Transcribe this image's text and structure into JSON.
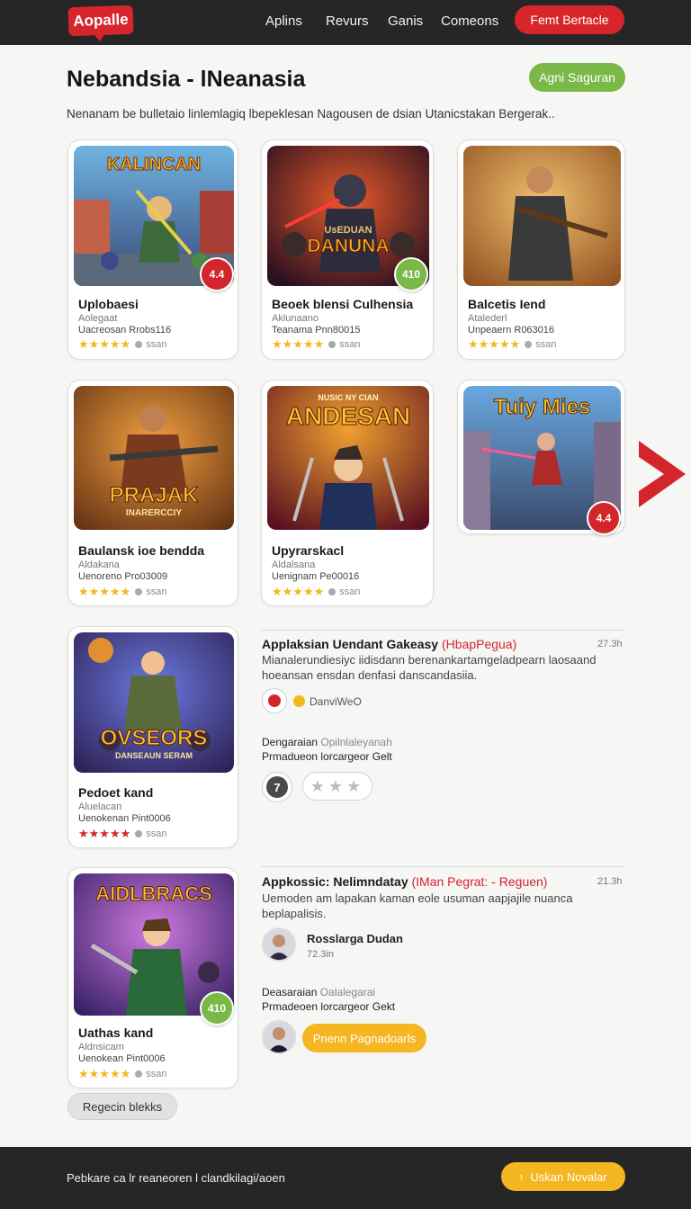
{
  "app": {
    "logo": "Aopalle"
  },
  "nav": {
    "items": [
      "Aplins",
      "Revurs",
      "Ganis",
      "Comeons"
    ],
    "cta": "Femt Bertacle"
  },
  "header": {
    "title": "Nebandsia - lNeanasia",
    "button": "Agni Saguran",
    "description": "Nenanam be bulletaio linlemlagiq lbepeklesan Nagousen de dsian Utanicstakan Bergerak.."
  },
  "cards": [
    {
      "art": "KALINCAN",
      "badge": "4.4",
      "badge_color": "red",
      "title": "Uplobaesi",
      "sub": "Aolegaat",
      "meta": "Uacreosan Rrobs116",
      "stars": "★★★★★",
      "rating_label": "ssan"
    },
    {
      "art": "DANUNA",
      "art_top": "UsEDUAN",
      "badge": "410",
      "badge_color": "green",
      "title": "Beoek blensi Culhensia",
      "sub": "Aklunaano",
      "meta": "Teanama Pnn80015",
      "stars": "★★★★★",
      "rating_label": "ssan"
    },
    {
      "art": "",
      "badge": "",
      "badge_color": "",
      "title": "Balcetis Iend",
      "sub": "Atalederl",
      "meta": "Unpeaern R063016",
      "stars": "★★★★★",
      "rating_label": "ssan"
    },
    {
      "art": "PRAJAK",
      "art_sub": "INARERCCIY",
      "badge": "",
      "badge_color": "",
      "title": "Baulansk ioe bendda",
      "sub": "Aldakana",
      "meta": "Uenoreno Pro03009",
      "stars": "★★★★★",
      "rating_label": "ssan"
    },
    {
      "art": "ANDESAN",
      "art_top": "NUSIC NY CIAN",
      "badge": "",
      "badge_color": "",
      "title": "Upyrarskacl",
      "sub": "Aldalsana",
      "meta": "Uenignam Pe00016",
      "stars": "★★★★★",
      "rating_label": "ssan"
    },
    {
      "art": "Tuiy Mies",
      "badge": "4.4",
      "badge_color": "red",
      "title": "",
      "sub": "",
      "meta": "",
      "stars": "",
      "rating_label": ""
    },
    {
      "art": "OVSEORS",
      "art_sub": "DANSEAUN SERAM",
      "badge": "",
      "badge_color": "",
      "title": "Pedoet kand",
      "sub": "Aluelacan",
      "meta": "Uenokenan Pint0006",
      "stars": "★★★★★",
      "rating_label": "ssan"
    },
    {
      "art": "AIDLBRACS",
      "badge": "410",
      "badge_color": "green",
      "title": "Uathas kand",
      "sub": "Aldnsicam",
      "meta": "Uenokean Pint0006",
      "stars": "★★★★★",
      "rating_label": "ssan"
    }
  ],
  "detail1": {
    "title": "Applaksian Uendant Gakeasy",
    "highlight": "(HbapPegua)",
    "time": "27.3h",
    "desc": "Mianalerundiesiyc iidisdann berenankartamgeladpearn laosaand hoeansan ensdan denfasi danscandasiia.",
    "dot_label": "DanviWeO",
    "label_line1": "Dengaraian",
    "label_line1_muted": "Opilnlaleyanah",
    "label_line2": "Prmadueon lorcargeor Gelt",
    "stars": "★★★"
  },
  "detail2": {
    "title": "Appkossic: Nelimndatay",
    "highlight": "(IMan Pegrat: - Reguen)",
    "time": "21.3h",
    "desc": "Uemoden am lapakan kaman eole usuman aapjajile nuanca beplapalisis.",
    "person_name": "Rosslarga Dudan",
    "person_time": "72.3in",
    "label_line1": "Deasaraian",
    "label_line1_muted": "Oalalegarai",
    "label_line2": "Prmadeoen lorcargeor Gekt",
    "button": "Pnenn Pagnadoarls"
  },
  "more_button": "Regecin blekks",
  "footer": {
    "text": "Pebkare ca lr reaneoren l clandkilagi/aoen",
    "button": "Uskan Novalar"
  },
  "colors": {
    "brand_red": "#d7262b",
    "green": "#7ab848",
    "yellow": "#f4b621",
    "dark": "#262626"
  }
}
